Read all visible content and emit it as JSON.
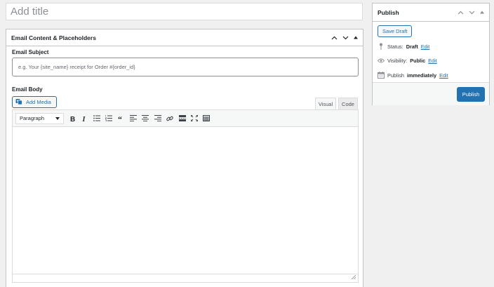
{
  "title": {
    "placeholder": "Add title",
    "value": ""
  },
  "email_box": {
    "heading": "Email Content & Placeholders",
    "subject_label": "Email Subject",
    "subject_placeholder": "e.g. Your {site_name} receipt for Order #{order_id}",
    "subject_value": "",
    "body_label": "Email Body",
    "add_media_label": "Add Media",
    "tabs": [
      {
        "label": "Visual",
        "active": true
      },
      {
        "label": "Code",
        "active": false
      }
    ],
    "format_select": "Paragraph",
    "toolbar_icons": [
      "bold-icon",
      "italic-icon",
      "bulleted-list-icon",
      "numbered-list-icon",
      "blockquote-icon",
      "align-left-icon",
      "align-center-icon",
      "align-right-icon",
      "link-icon",
      "read-more-icon",
      "fullscreen-icon",
      "toolbar-toggle-icon"
    ],
    "body_value": ""
  },
  "publish_box": {
    "heading": "Publish",
    "save_draft_label": "Save Draft",
    "status_label": "Status:",
    "status_value": "Draft",
    "visibility_label": "Visibility:",
    "visibility_value": "Public",
    "publish_label": "Publish",
    "publish_value": "immediately",
    "edit_label": "Edit",
    "publish_button_label": "Publish"
  },
  "colors": {
    "accent": "#2271b1",
    "background": "#f0f0f1",
    "border": "#c3c4c7",
    "panel": "#ffffff"
  }
}
